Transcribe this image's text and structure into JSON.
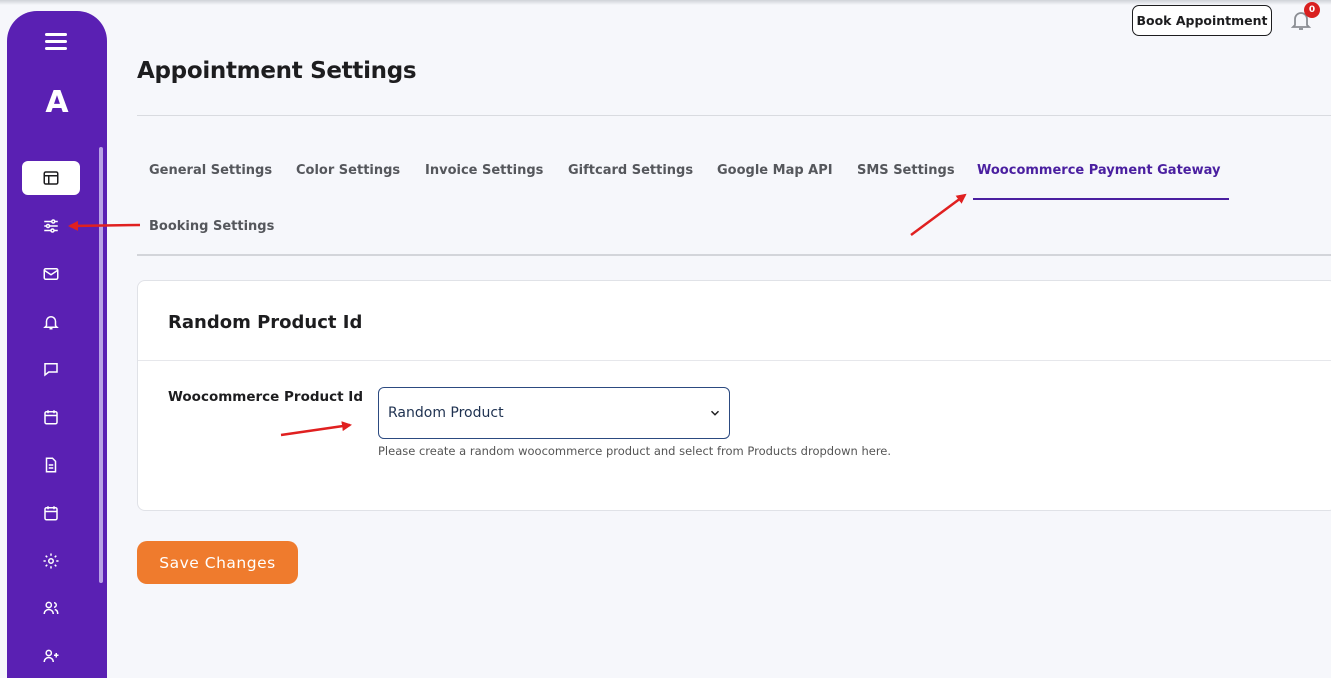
{
  "app": {
    "logo_letter": "A",
    "accent_color": "#5a20b3",
    "cta_color": "#ef7b2d"
  },
  "header": {
    "book_appointment_label": "Book Appointment",
    "notification_count": "0"
  },
  "sidebar": {
    "items": [
      {
        "icon": "layout-icon",
        "active": true
      },
      {
        "icon": "sliders-icon",
        "active": false
      },
      {
        "icon": "mail-icon",
        "active": false
      },
      {
        "icon": "bell-icon",
        "active": false
      },
      {
        "icon": "chat-icon",
        "active": false
      },
      {
        "icon": "calendar-icon",
        "active": false
      },
      {
        "icon": "document-icon",
        "active": false
      },
      {
        "icon": "calendar-icon",
        "active": false
      },
      {
        "icon": "gear-icon",
        "active": false
      },
      {
        "icon": "users-icon",
        "active": false
      },
      {
        "icon": "add-user-icon",
        "active": false
      }
    ]
  },
  "page": {
    "title": "Appointment Settings"
  },
  "tabs": [
    {
      "label": "General Settings"
    },
    {
      "label": "Color Settings"
    },
    {
      "label": "Invoice Settings"
    },
    {
      "label": "Giftcard Settings"
    },
    {
      "label": "Google Map API"
    },
    {
      "label": "SMS Settings"
    },
    {
      "label": "Woocommerce Payment Gateway",
      "active": true
    },
    {
      "label": "Booking Settings"
    }
  ],
  "card": {
    "title": "Random Product Id",
    "field_label": "Woocommerce Product Id",
    "select_value": "Random Product",
    "help_text": "Please create a random woocommerce product and select from Products dropdown here."
  },
  "actions": {
    "save_label": "Save Changes"
  },
  "annotations": {
    "arrow_color": "#e02020"
  }
}
